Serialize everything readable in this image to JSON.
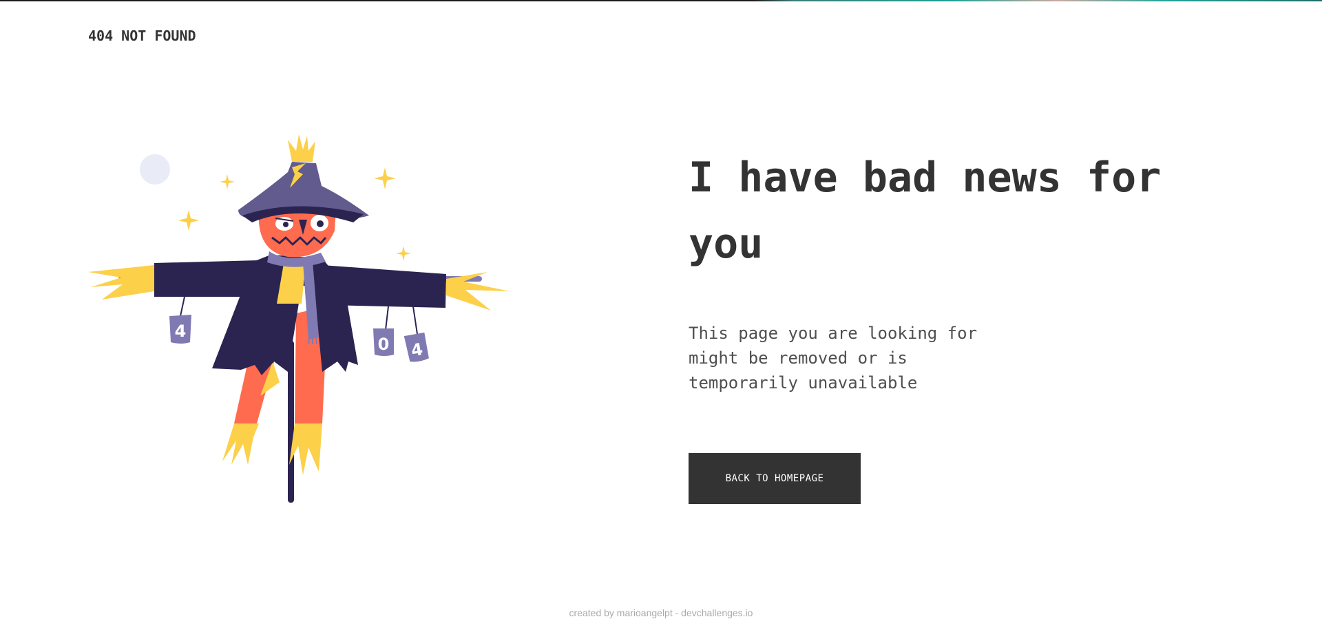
{
  "header": {
    "brand": "404 NOT FOUND"
  },
  "illustration": {
    "name": "scarecrow",
    "can_labels": [
      "4",
      "0",
      "4"
    ]
  },
  "main": {
    "headline": "I have bad news for you",
    "description": "This page you are looking for might be removed or is temporarily unavailable",
    "button_label": "BACK TO HOMEPAGE"
  },
  "footer": {
    "credit": "created by marioangelpt - devchallenges.io"
  },
  "colors": {
    "text": "#333333",
    "button_bg": "#333333",
    "button_text": "#ffffff",
    "coat": "#2b2451",
    "hat": "#625b8d",
    "pumpkin": "#ff6b4f",
    "straw": "#fdd04a",
    "can": "#807ab2",
    "moon": "#e9ebf7",
    "footer_text": "#a9a9a9"
  }
}
